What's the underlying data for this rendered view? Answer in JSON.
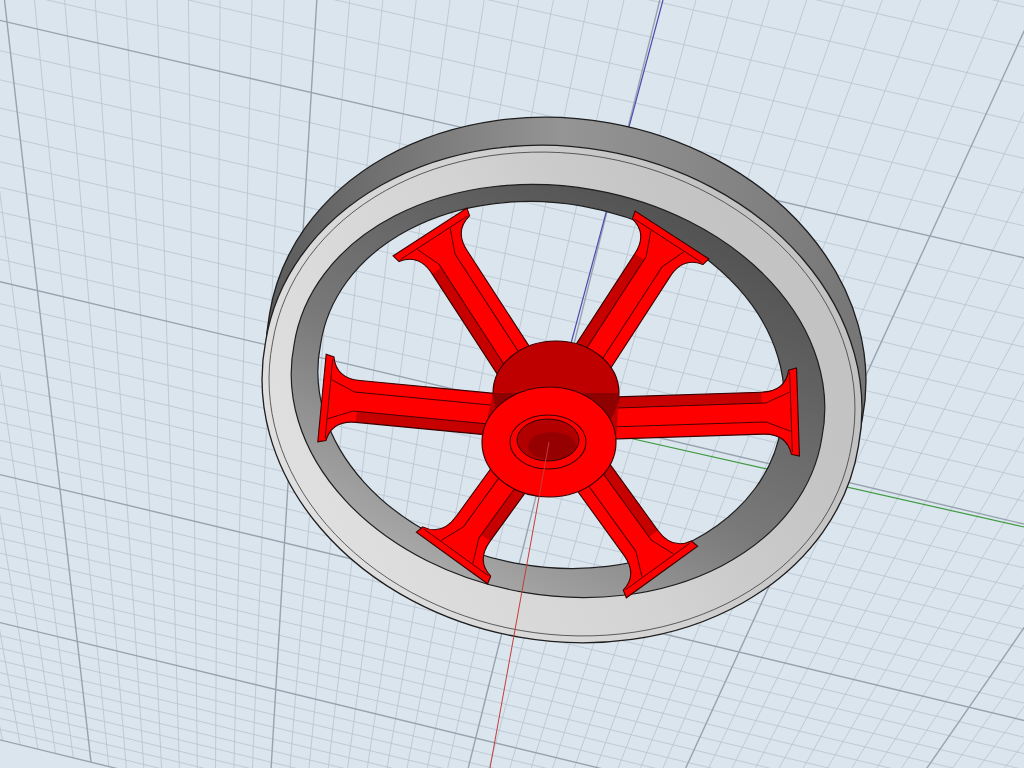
{
  "viewport": {
    "axes": [
      {
        "color": "#c43c3c"
      },
      {
        "color": "#3f9a3f"
      },
      {
        "color": "#4c4cae"
      }
    ],
    "model": {
      "parts": [
        {
          "kind": "rim",
          "color": "#cdcdcd"
        },
        {
          "kind": "spoke",
          "color": "#ff0000"
        },
        {
          "kind": "spoke",
          "color": "#ff0000"
        },
        {
          "kind": "spoke",
          "color": "#ff0000"
        },
        {
          "kind": "spoke",
          "color": "#ff0000"
        },
        {
          "kind": "spoke",
          "color": "#ff0000"
        },
        {
          "kind": "spoke",
          "color": "#ff0000"
        },
        {
          "kind": "hub",
          "color": "#ff0000"
        }
      ]
    }
  }
}
